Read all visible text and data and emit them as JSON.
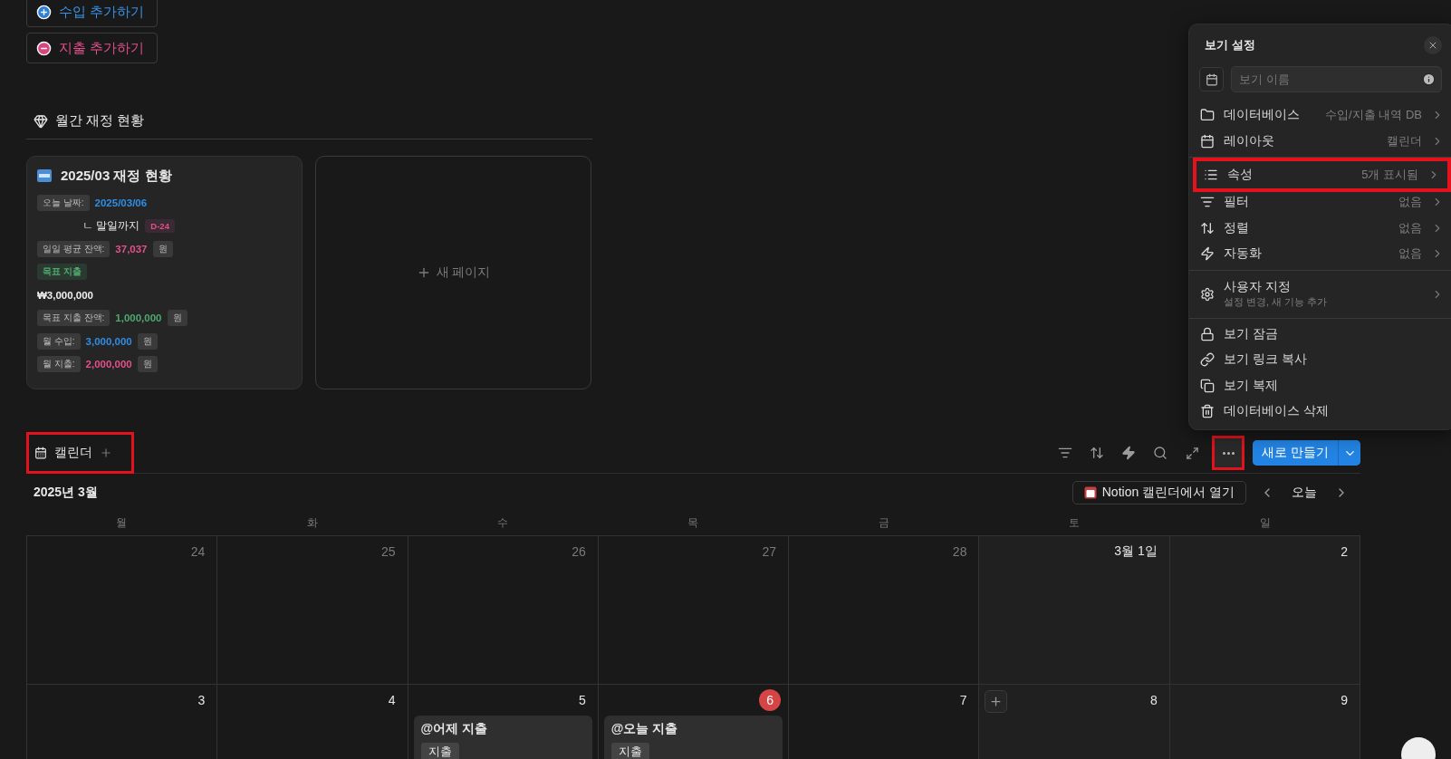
{
  "actions": [
    {
      "label": "수입 추가하기",
      "kind": "add"
    },
    {
      "label": "지출 추가하기",
      "kind": "remove"
    }
  ],
  "section": {
    "title": "월간 재정 현황"
  },
  "card": {
    "title": "2025/03 재정 현황",
    "lines": [
      {
        "kind": "pair",
        "label": "오늘 날짜:",
        "value": "2025/03/06",
        "color": "#2f8de4"
      },
      {
        "kind": "sub",
        "text": "ㄴ 말일까지",
        "badge": "D-24"
      },
      {
        "kind": "pair",
        "label": "일일 평균 잔액:",
        "value": "37,037",
        "color": "#e2508a",
        "unit": "원"
      },
      {
        "kind": "tag",
        "text": "목표 지출"
      },
      {
        "kind": "plain",
        "text": "₩3,000,000"
      },
      {
        "kind": "pair",
        "label": "목표 지출 잔액:",
        "value": "1,000,000",
        "color": "#4fa86e",
        "unit": "원"
      },
      {
        "kind": "pair",
        "label": "월 수입:",
        "value": "3,000,000",
        "color": "#2f8de4",
        "unit": "원"
      },
      {
        "kind": "pair",
        "label": "월 지출:",
        "value": "2,000,000",
        "color": "#e2508a",
        "unit": "원"
      }
    ]
  },
  "new_page": {
    "label": "새 페이지"
  },
  "calendar": {
    "tab": {
      "label": "캘린더",
      "highlighted": true
    },
    "toolbar": {
      "more_highlighted": true,
      "new_button": "새로 만들기"
    },
    "month": "2025년 3월",
    "open_button": "Notion 캘린더에서 열기",
    "today_button": "오늘",
    "weekdays": [
      "월",
      "화",
      "수",
      "목",
      "금",
      "토",
      "일"
    ],
    "weeks": [
      [
        {
          "label": "24",
          "muted": true
        },
        {
          "label": "25",
          "muted": true
        },
        {
          "label": "26",
          "muted": true
        },
        {
          "label": "27",
          "muted": true
        },
        {
          "label": "28",
          "muted": true
        },
        {
          "label": "3월 1일",
          "muted": false
        },
        {
          "label": "2",
          "muted": false
        }
      ],
      [
        {
          "label": "3",
          "muted": false
        },
        {
          "label": "4",
          "muted": false
        },
        {
          "label": "5",
          "muted": false,
          "events": [
            {
              "title": "@어제 지출",
              "tag": "지출"
            }
          ]
        },
        {
          "label": "6",
          "muted": false,
          "today": true,
          "events": [
            {
              "title": "@오늘 지출",
              "tag": "지출"
            }
          ]
        },
        {
          "label": "7",
          "muted": false
        },
        {
          "label": "8",
          "muted": false,
          "hovered": true
        },
        {
          "label": "9",
          "muted": false
        }
      ]
    ]
  },
  "view_settings": {
    "title": "보기 설정",
    "name_placeholder": "보기 이름",
    "groups": [
      [
        {
          "label": "데이터베이스",
          "value": "수입/지출 내역 DB",
          "highlighted": false
        },
        {
          "label": "레이아웃",
          "value": "캘린더",
          "highlighted": false
        }
      ],
      [
        {
          "label": "속성",
          "value": "5개 표시됨",
          "highlighted": true
        },
        {
          "label": "필터",
          "value": "없음",
          "highlighted": false
        },
        {
          "label": "정렬",
          "value": "없음",
          "highlighted": false
        },
        {
          "label": "자동화",
          "value": "없음",
          "highlighted": false
        }
      ],
      [
        {
          "label": "사용자 지정",
          "subtitle": "설정 변경, 새 기능 추가",
          "highlighted": false
        }
      ],
      [
        {
          "label": "보기 잠금"
        },
        {
          "label": "보기 링크 복사"
        },
        {
          "label": "보기 복제"
        },
        {
          "label": "데이터베이스 삭제"
        }
      ]
    ]
  }
}
